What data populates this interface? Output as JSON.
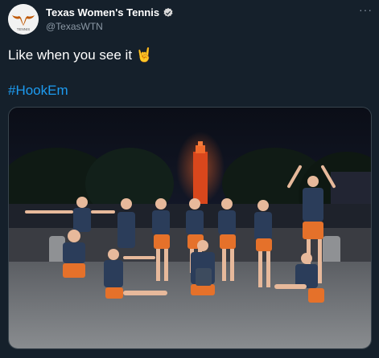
{
  "tweet": {
    "author": {
      "display_name": "Texas Women's Tennis",
      "handle": "@TexasWTN",
      "avatar_text": "TENNIS",
      "verified_icon": "verified-badge-icon"
    },
    "more_icon": "more-options-icon",
    "text": "Like when you see it 🤘",
    "hashtag": "#HookEm",
    "media": {
      "description_icon": "team-photo-image"
    }
  },
  "colors": {
    "background": "#15202b",
    "accent": "#1d9bf0",
    "burnt_orange": "#bf5700",
    "secondary_text": "#8b98a5"
  }
}
